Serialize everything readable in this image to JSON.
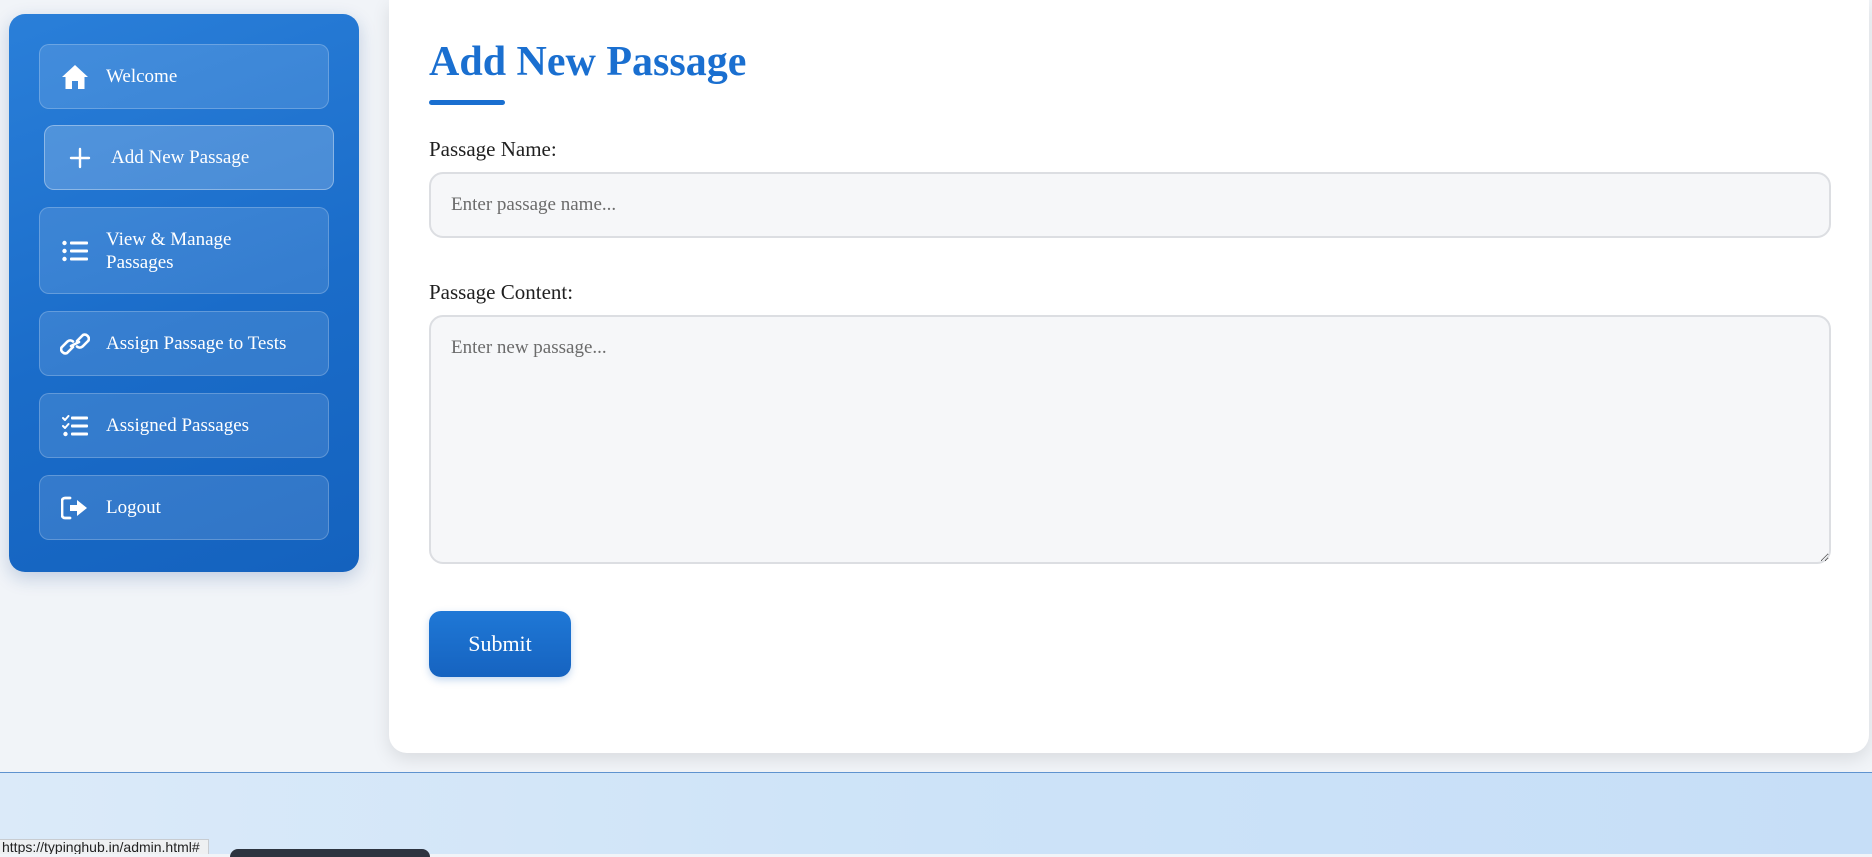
{
  "sidebar": {
    "items": [
      {
        "label": "Welcome",
        "icon": "home-icon"
      },
      {
        "label": "Add New Passage",
        "icon": "plus-icon",
        "active": true
      },
      {
        "label": "View & Manage Passages",
        "icon": "list-icon"
      },
      {
        "label": "Assign Passage to Tests",
        "icon": "link-icon"
      },
      {
        "label": "Assigned Passages",
        "icon": "checklist-icon"
      },
      {
        "label": "Logout",
        "icon": "logout-icon"
      }
    ]
  },
  "main": {
    "title": "Add New Passage",
    "name_label": "Passage Name:",
    "name_placeholder": "Enter passage name...",
    "name_value": "",
    "content_label": "Passage Content:",
    "content_placeholder": "Enter new passage...",
    "content_value": "",
    "submit_label": "Submit"
  },
  "status_bar": {
    "url": "https://typinghub.in/admin.html#"
  },
  "colors": {
    "accent": "#1a6fd0",
    "sidebar": "#1a6cc9",
    "background": "#f1f4f8"
  }
}
